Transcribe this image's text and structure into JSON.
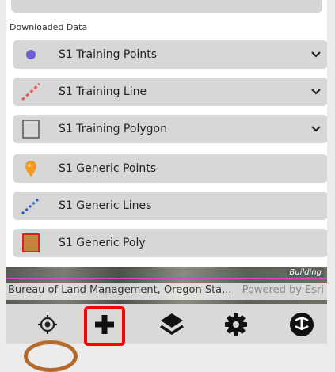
{
  "section_title": "Downloaded Data",
  "layers": [
    {
      "label": "S1 Training Points",
      "icon": "blue-dot-icon",
      "expandable": true
    },
    {
      "label": "S1 Training Line",
      "icon": "red-dashed-line-icon",
      "expandable": true
    },
    {
      "label": "S1 Training Polygon",
      "icon": "empty-square-icon",
      "expandable": true
    },
    {
      "label": "S1 Generic Points",
      "icon": "orange-pin-icon",
      "expandable": false
    },
    {
      "label": "S1 Generic Lines",
      "icon": "blue-dashed-line-icon",
      "expandable": false
    },
    {
      "label": "S1 Generic Poly",
      "icon": "brown-square-icon",
      "expandable": false
    }
  ],
  "map": {
    "building_tag": "Building",
    "attribution": "Bureau of Land Management, Oregon Sta...",
    "powered_by": "Powered by Esri"
  },
  "toolbar": {
    "buttons": [
      "locate-icon",
      "add-icon",
      "layers-icon",
      "settings-icon",
      "profile-logo-icon"
    ]
  },
  "colors": {
    "highlight": "#ff0000",
    "point_blue": "#6a5fd6",
    "line_red": "#e15b5b",
    "pin_orange": "#f39a1f",
    "line_blue": "#1f5ed8",
    "poly_fill": "#c4843b"
  }
}
